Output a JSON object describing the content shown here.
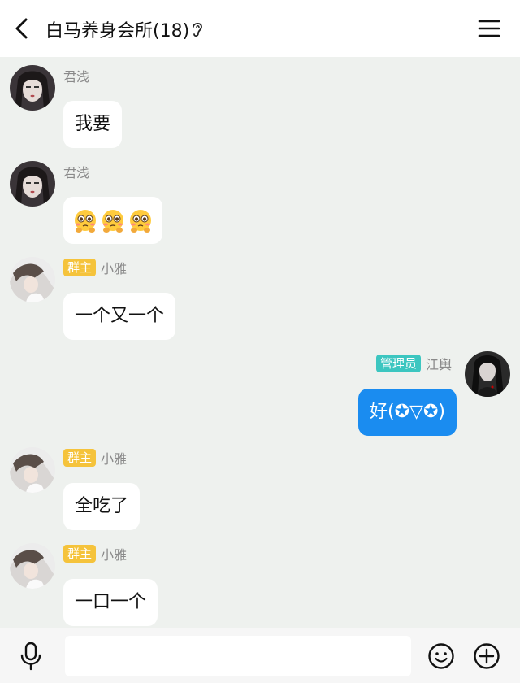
{
  "header": {
    "title": "白马养身会所(18)",
    "back_icon": "chevron-left-icon",
    "ear_icon": "ear-icon",
    "menu_icon": "hamburger-menu-icon"
  },
  "messages": [
    {
      "sender": "君浅",
      "badge": "",
      "text": "我要",
      "mine": false
    },
    {
      "sender": "君浅",
      "badge": "",
      "text": "",
      "emoji": [
        "pleading-face-emoji",
        "pleading-face-emoji",
        "pleading-face-emoji"
      ],
      "mine": false
    },
    {
      "sender": "小雅",
      "badge": "群主",
      "text": "一个又一个",
      "mine": false
    },
    {
      "sender": "江舆",
      "badge": "管理员",
      "text": "好(✪▽✪)",
      "mine": true
    },
    {
      "sender": "小雅",
      "badge": "群主",
      "text": "全吃了",
      "mine": false
    },
    {
      "sender": "小雅",
      "badge": "群主",
      "text": "一口一个",
      "mine": false
    }
  ],
  "footer": {
    "input_value": "",
    "input_placeholder": "",
    "mic_icon": "microphone-icon",
    "emoji_icon": "smiley-icon",
    "plus_icon": "plus-circle-icon"
  },
  "colors": {
    "background": "#eef1ee",
    "my_bubble": "#1a8cf0",
    "owner_badge": "#f5c33b",
    "admin_badge": "#3cc6c0"
  }
}
